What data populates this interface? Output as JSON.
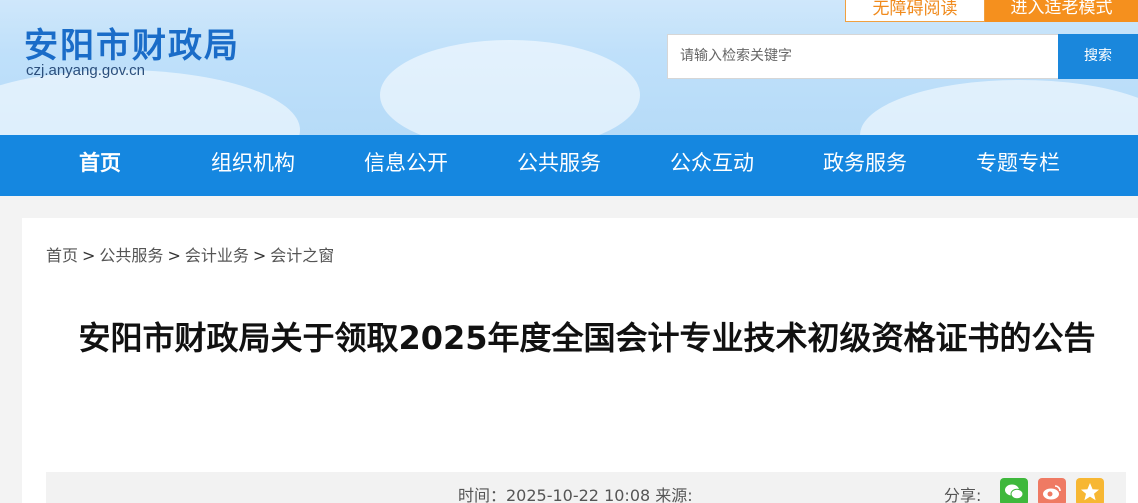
{
  "header": {
    "site_title": "安阳市财政局",
    "site_domain": "czj.anyang.gov.cn",
    "a11y_button": "无障碍阅读",
    "elder_button": "进入适老模式",
    "search_placeholder": "请输入检索关键字",
    "search_button": "搜索"
  },
  "nav": {
    "items": [
      "首页",
      "组织机构",
      "信息公开",
      "公共服务",
      "公众互动",
      "政务服务",
      "专题专栏"
    ]
  },
  "breadcrumb": [
    "首页",
    "公共服务",
    "会计业务",
    "会计之窗"
  ],
  "breadcrumb_sep": ">",
  "article": {
    "title": "安阳市财政局关于领取2025年度全国会计专业技术初级资格证书的公告",
    "meta": "时间：2025-10-22 10:08 来源:",
    "share_label": "分享:"
  },
  "icons": {
    "wechat": "wechat-icon",
    "weibo": "weibo-icon",
    "qzone": "star-icon"
  },
  "colors": {
    "nav": "#1587e0",
    "brand": "#1a6cc8",
    "orange": "#f5901e"
  }
}
